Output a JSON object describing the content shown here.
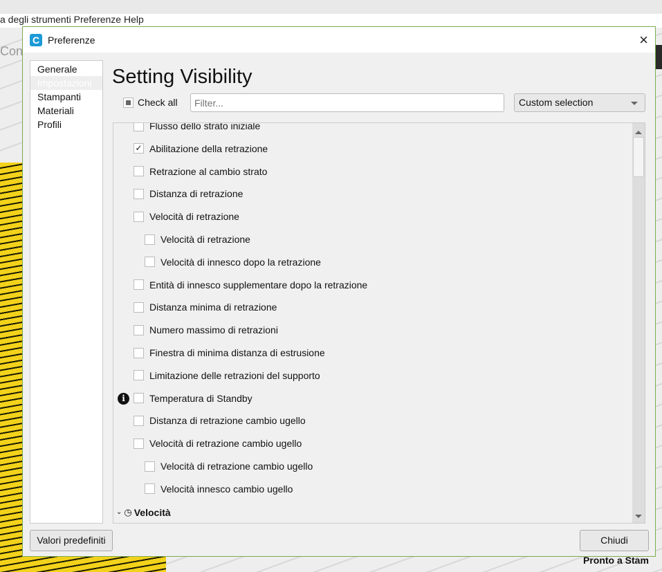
{
  "background": {
    "menu": "a degli strumenti  Preferenze  Help",
    "side_text": "Con",
    "status": "Pronto a Stam"
  },
  "dialog": {
    "title": "Preferenze",
    "close": "×"
  },
  "sidebar": {
    "items": [
      {
        "label": "Generale"
      },
      {
        "label": "Impostazioni"
      },
      {
        "label": "Stampanti"
      },
      {
        "label": "Materiali"
      },
      {
        "label": "Profili"
      }
    ]
  },
  "main": {
    "heading": "Setting Visibility",
    "check_all": "Check all",
    "filter_placeholder": "Filter...",
    "dropdown": "Custom selection",
    "settings": [
      {
        "label": "Flusso dello strato iniziale",
        "checked": false,
        "level": 1
      },
      {
        "label": "Abilitazione della retrazione",
        "checked": true,
        "level": 1
      },
      {
        "label": "Retrazione al cambio strato",
        "checked": false,
        "level": 1
      },
      {
        "label": "Distanza di retrazione",
        "checked": false,
        "level": 1
      },
      {
        "label": "Velocità di retrazione",
        "checked": false,
        "level": 1
      },
      {
        "label": "Velocità di retrazione",
        "checked": false,
        "level": 2
      },
      {
        "label": "Velocità di innesco dopo la retrazione",
        "checked": false,
        "level": 2
      },
      {
        "label": "Entità di innesco supplementare dopo la retrazione",
        "checked": false,
        "level": 1
      },
      {
        "label": "Distanza minima di retrazione",
        "checked": false,
        "level": 1
      },
      {
        "label": "Numero massimo di retrazioni",
        "checked": false,
        "level": 1
      },
      {
        "label": "Finestra di minima distanza di estrusione",
        "checked": false,
        "level": 1
      },
      {
        "label": "Limitazione delle retrazioni del supporto",
        "checked": false,
        "level": 1
      },
      {
        "label": "Temperatura di Standby",
        "checked": false,
        "level": 1,
        "info": true
      },
      {
        "label": "Distanza di retrazione cambio ugello",
        "checked": false,
        "level": 1
      },
      {
        "label": "Velocità di retrazione cambio ugello",
        "checked": false,
        "level": 1
      },
      {
        "label": "Velocità di retrazione cambio ugello",
        "checked": false,
        "level": 2
      },
      {
        "label": "Velocità innesco cambio ugello",
        "checked": false,
        "level": 2
      }
    ],
    "category": "Velocità"
  },
  "buttons": {
    "defaults": "Valori predefiniti",
    "close": "Chiudi"
  }
}
